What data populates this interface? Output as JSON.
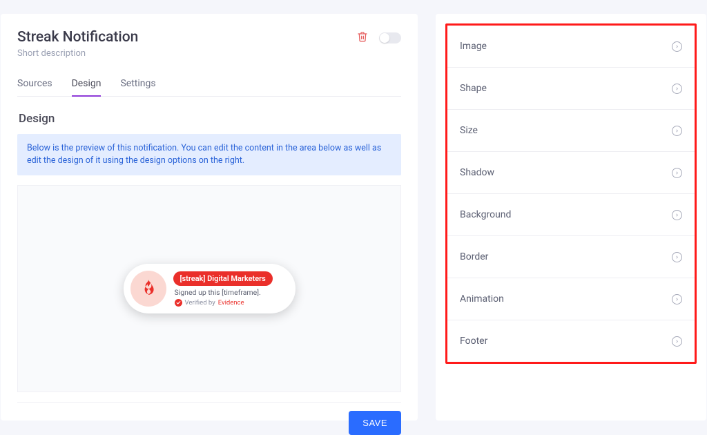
{
  "header": {
    "title": "Streak Notification",
    "subtitle": "Short description"
  },
  "tabs": {
    "sources": "Sources",
    "design": "Design",
    "settings": "Settings",
    "active": "design"
  },
  "section": {
    "heading": "Design",
    "info_text": "Below is the preview of this notification. You can edit the content in the area below as well as edit the design of it using the design options on the right."
  },
  "notification": {
    "pill": "[streak] Digital Marketers",
    "line2": "Signed up this [timeframe].",
    "verified_prefix": "Verified by ",
    "brand": "Evidence"
  },
  "actions": {
    "save": "SAVE"
  },
  "design_options": {
    "items": [
      {
        "label": "Image"
      },
      {
        "label": "Shape"
      },
      {
        "label": "Size"
      },
      {
        "label": "Shadow"
      },
      {
        "label": "Background"
      },
      {
        "label": "Border"
      },
      {
        "label": "Animation"
      },
      {
        "label": "Footer"
      }
    ]
  }
}
